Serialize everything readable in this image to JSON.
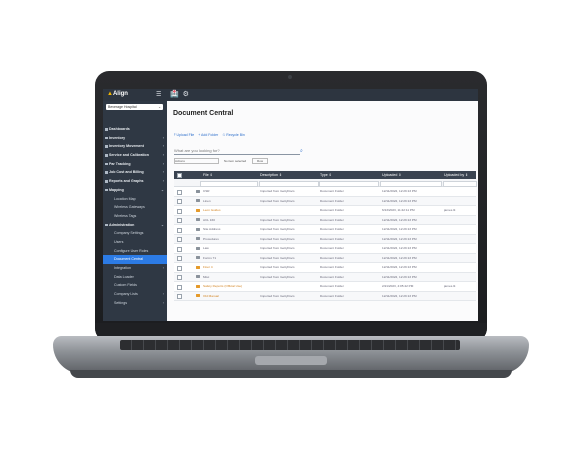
{
  "app": {
    "name": "Align",
    "hospital_selector": "Beverage Hospital",
    "top_icons": "🏥 ⚙"
  },
  "sidebar": {
    "items": [
      {
        "label": "Dashboards",
        "type": "main"
      },
      {
        "label": "Inventory",
        "type": "main",
        "arrow": "›"
      },
      {
        "label": "Inventory Movement",
        "type": "main",
        "arrow": "›"
      },
      {
        "label": "Service and Calibration",
        "type": "main",
        "arrow": "›"
      },
      {
        "label": "Par Tracking",
        "type": "main",
        "arrow": "›"
      },
      {
        "label": "Job Cost and Billing",
        "type": "main",
        "arrow": "›"
      },
      {
        "label": "Reports and Graphs",
        "type": "main",
        "arrow": "›"
      },
      {
        "label": "Mapping",
        "type": "main",
        "arrow": "⌄"
      },
      {
        "label": "Location Map",
        "type": "sub"
      },
      {
        "label": "Wireless Gateways",
        "type": "sub"
      },
      {
        "label": "Wireless Tags",
        "type": "sub"
      },
      {
        "label": "Administration",
        "type": "main",
        "arrow": "⌄"
      },
      {
        "label": "Company Settings",
        "type": "sub"
      },
      {
        "label": "Users",
        "type": "sub"
      },
      {
        "label": "Configure User Roles",
        "type": "sub"
      },
      {
        "label": "Document Central",
        "type": "sub",
        "active": true
      },
      {
        "label": "Integration",
        "type": "sub",
        "arrow": "›"
      },
      {
        "label": "Data Loader",
        "type": "sub"
      },
      {
        "label": "Custom Fields",
        "type": "sub"
      },
      {
        "label": "Company Lists",
        "type": "sub",
        "arrow": "›"
      },
      {
        "label": "Settings",
        "type": "sub",
        "arrow": "›"
      }
    ]
  },
  "main": {
    "title": "Document Central",
    "actions": [
      "⤒ Upload File",
      "+ Add Folder",
      "♲ Recycle Bin"
    ],
    "search_placeholder": "What are you looking for?",
    "filter_select": "Actions",
    "filter_text": "No item selected",
    "filter_button": "Row"
  },
  "table": {
    "headers": [
      "File ⇕",
      "Description ⇕",
      "Type ⇕",
      "Uploaded ⇕",
      "Uploaded by ⇕"
    ],
    "rows": [
      {
        "name": "CSR",
        "orange": false,
        "desc": "Imported from GettyDocs",
        "type": "Document Folder",
        "date": "12/11/2022, 12:29:13 PM",
        "by": ""
      },
      {
        "name": "Linen",
        "orange": false,
        "desc": "Imported from GettyDocs",
        "type": "Document Folder",
        "date": "12/11/2022, 12:29:13 PM",
        "by": ""
      },
      {
        "name": "Leon Guides",
        "orange": true,
        "desc": "",
        "type": "Document Folder",
        "date": "6/13/2023, 11:42:11 PM",
        "by": "james.lit"
      },
      {
        "name": "ACL 160",
        "orange": false,
        "desc": "Imported from GettyDocs",
        "type": "Document Folder",
        "date": "12/11/2022, 12:29:13 PM",
        "by": ""
      },
      {
        "name": "Site Address",
        "orange": false,
        "desc": "Imported from GettyDocs",
        "type": "Document Folder",
        "date": "12/11/2022, 12:29:13 PM",
        "by": ""
      },
      {
        "name": "Procedures",
        "orange": false,
        "desc": "Imported from GettyDocs",
        "type": "Document Folder",
        "date": "12/11/2022, 12:29:13 PM",
        "by": ""
      },
      {
        "name": "Law",
        "orange": false,
        "desc": "Imported from GettyDocs",
        "type": "Document Folder",
        "date": "12/11/2022, 12:29:13 PM",
        "by": ""
      },
      {
        "name": "Forms 71",
        "orange": false,
        "desc": "Imported from GettyDocs",
        "type": "Document Folder",
        "date": "12/11/2022, 12:29:13 PM",
        "by": ""
      },
      {
        "name": "Floor 4",
        "orange": true,
        "desc": "Imported from GettyDocs",
        "type": "Document Folder",
        "date": "12/11/2022, 12:29:13 PM",
        "by": ""
      },
      {
        "name": "Misc",
        "orange": false,
        "desc": "Imported from GettyDocs",
        "type": "Document Folder",
        "date": "12/11/2022, 12:29:13 PM",
        "by": ""
      },
      {
        "name": "Safety Reports (Official Use)",
        "orange": true,
        "desc": "",
        "type": "Document Folder",
        "date": "2/21/2023, 4:05:42 PM",
        "by": "james.lit"
      },
      {
        "name": "Old Manual",
        "orange": true,
        "desc": "Imported from GettyDocs",
        "type": "Document Folder",
        "date": "12/11/2022, 12:29:13 PM",
        "by": ""
      }
    ]
  }
}
